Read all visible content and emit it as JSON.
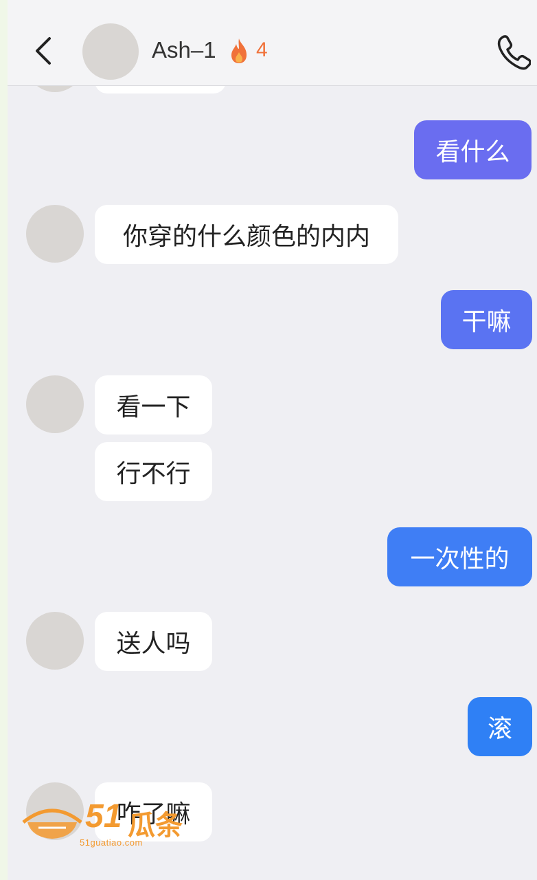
{
  "header": {
    "name": "Ash–1",
    "streak_count": "4",
    "back_icon": "chevron-left-icon",
    "call_icon": "phone-icon",
    "streak_icon": "fire-icon"
  },
  "messages": [
    {
      "side": "in",
      "text": ""
    },
    {
      "side": "out",
      "text": "看什么"
    },
    {
      "side": "in",
      "text": "你穿的什么颜色的内内"
    },
    {
      "side": "out",
      "text": "干嘛"
    },
    {
      "side": "in",
      "text": "看一下"
    },
    {
      "side": "in",
      "text": "行不行"
    },
    {
      "side": "out",
      "text": "一次性的"
    },
    {
      "side": "in",
      "text": "送人吗"
    },
    {
      "side": "out",
      "text": "滚"
    },
    {
      "side": "in",
      "text": "咋了嘛"
    }
  ],
  "watermark": {
    "brand_number": "51",
    "brand_text": "瓜条",
    "url": "51guatiao.com"
  },
  "colors": {
    "outgoing_bubble_top": "#6f6cf0",
    "outgoing_bubble_bottom": "#2f80f5",
    "incoming_bubble": "#ffffff",
    "background": "#efeff3",
    "streak": "#f0723a",
    "watermark": "#f39a30"
  }
}
